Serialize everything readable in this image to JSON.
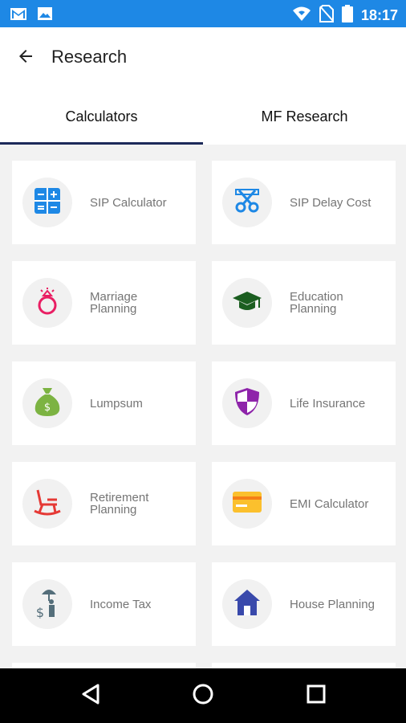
{
  "status_bar": {
    "time": "18:17",
    "icons": [
      "gmail-icon",
      "gallery-icon",
      "wifi-icon",
      "no-sim-icon",
      "battery-icon"
    ]
  },
  "header": {
    "title": "Research",
    "back_icon": "arrow-left-icon"
  },
  "tabs": [
    {
      "label": "Calculators",
      "active": true
    },
    {
      "label": "MF Research",
      "active": false
    }
  ],
  "cards": [
    {
      "label": "SIP Calculator",
      "icon": "calculator-icon",
      "color": "#1e88e5"
    },
    {
      "label": "SIP Delay Cost",
      "icon": "scissors-icon",
      "color": "#1e88e5"
    },
    {
      "label": "Marriage Planning",
      "icon": "ring-icon",
      "color": "#e91e63"
    },
    {
      "label": "Education Planning",
      "icon": "graduation-cap-icon",
      "color": "#1b5e20"
    },
    {
      "label": "Lumpsum",
      "icon": "money-bag-icon",
      "color": "#7cb342"
    },
    {
      "label": "Life Insurance",
      "icon": "shield-icon",
      "color": "#8e24aa"
    },
    {
      "label": "Retirement Planning",
      "icon": "rocking-chair-icon",
      "color": "#e53935"
    },
    {
      "label": "EMI Calculator",
      "icon": "credit-card-icon",
      "color": "#fbc02d"
    },
    {
      "label": "Income Tax",
      "icon": "umbrella-man-icon",
      "color": "#546e7a"
    },
    {
      "label": "House Planning",
      "icon": "house-icon",
      "color": "#3949ab"
    }
  ],
  "nav": [
    "back-triangle-icon",
    "home-circle-icon",
    "recents-square-icon"
  ]
}
